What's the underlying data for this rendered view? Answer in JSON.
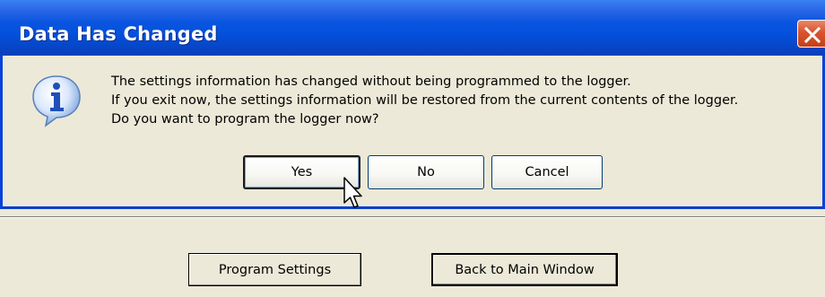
{
  "dialog": {
    "title": "Data Has Changed",
    "close_icon": "close-icon",
    "info_icon": "info-icon",
    "message_lines": [
      "The settings information has changed without being programmed to the logger.",
      "If you exit now, the settings information will be restored from the current contents of the logger.",
      "Do you want to program the logger now?"
    ],
    "buttons": {
      "yes": "Yes",
      "no": "No",
      "cancel": "Cancel"
    }
  },
  "background_window": {
    "buttons": {
      "program_settings": "Program Settings",
      "back_to_main": "Back to Main Window"
    }
  },
  "colors": {
    "titlebar": "#0451dd",
    "close": "#d9542e",
    "window_bg": "#ece9d8"
  }
}
